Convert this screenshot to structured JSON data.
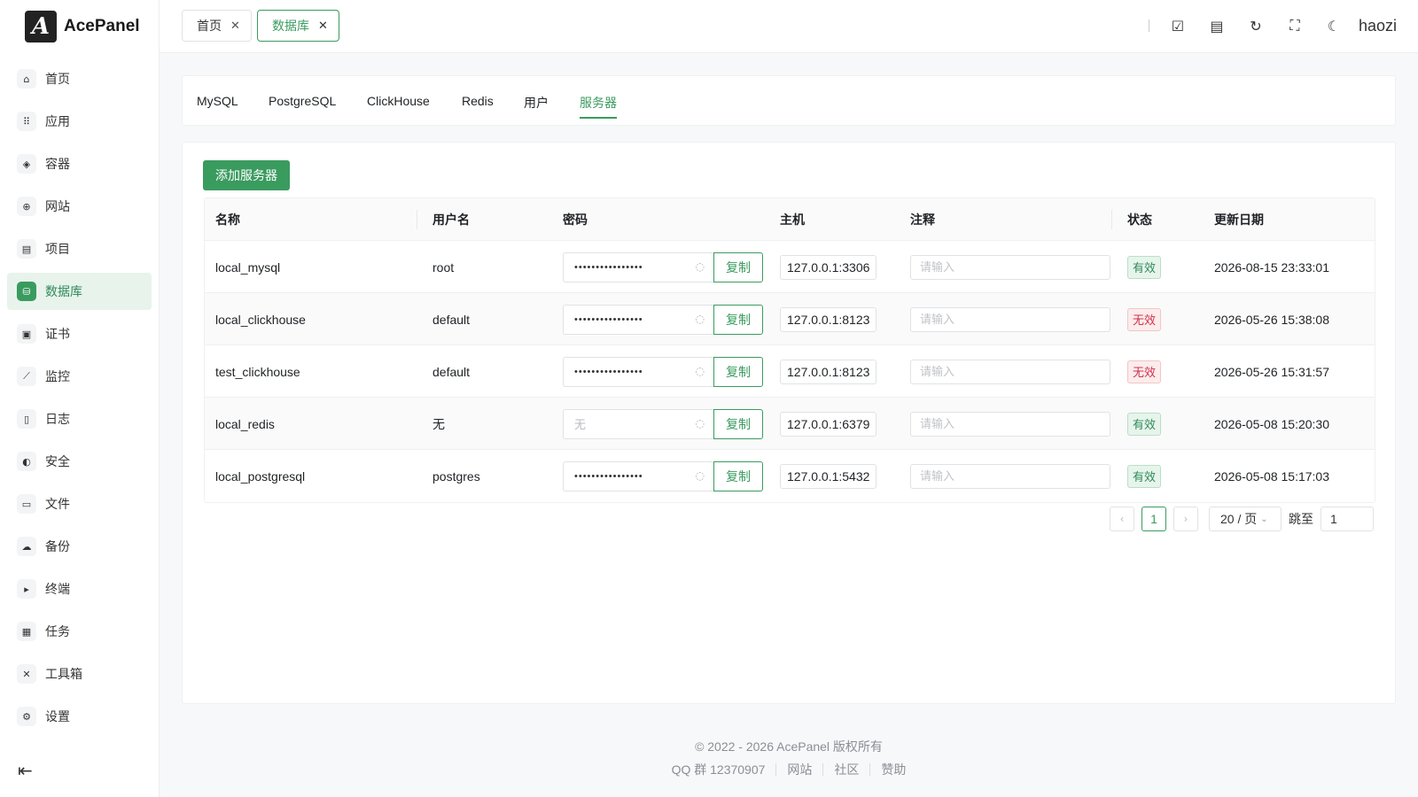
{
  "app": {
    "logo_letter": "A",
    "name": "AcePanel"
  },
  "sidebar": {
    "items": [
      {
        "label": "首页",
        "icon": "home-icon",
        "glyph": "⌂",
        "active": false
      },
      {
        "label": "应用",
        "icon": "apps-grid-icon",
        "glyph": "⠿",
        "active": false
      },
      {
        "label": "容器",
        "icon": "layers-icon",
        "glyph": "◈",
        "active": false
      },
      {
        "label": "网站",
        "icon": "globe-icon",
        "glyph": "⊕",
        "active": false
      },
      {
        "label": "项目",
        "icon": "folders-icon",
        "glyph": "▤",
        "active": false
      },
      {
        "label": "数据库",
        "icon": "database-icon",
        "glyph": "⛁",
        "active": true
      },
      {
        "label": "证书",
        "icon": "certificate-icon",
        "glyph": "▣",
        "active": false
      },
      {
        "label": "监控",
        "icon": "chart-line-icon",
        "glyph": "⟋",
        "active": false
      },
      {
        "label": "日志",
        "icon": "document-icon",
        "glyph": "▯",
        "active": false
      },
      {
        "label": "安全",
        "icon": "shield-icon",
        "glyph": "◐",
        "active": false
      },
      {
        "label": "文件",
        "icon": "folder-open-icon",
        "glyph": "▭",
        "active": false
      },
      {
        "label": "备份",
        "icon": "cloud-upload-icon",
        "glyph": "☁",
        "active": false
      },
      {
        "label": "终端",
        "icon": "terminal-icon",
        "glyph": "▸",
        "active": false
      },
      {
        "label": "任务",
        "icon": "calendar-task-icon",
        "glyph": "▦",
        "active": false
      },
      {
        "label": "工具箱",
        "icon": "tools-icon",
        "glyph": "✕",
        "active": false
      },
      {
        "label": "设置",
        "icon": "gear-icon",
        "glyph": "⚙",
        "active": false
      }
    ],
    "collapse_glyph": "⇤"
  },
  "topbar": {
    "tabs": [
      {
        "label": "首页",
        "active": false
      },
      {
        "label": "数据库",
        "active": true
      }
    ],
    "close_glyph": "✕",
    "icons": [
      {
        "name": "checklist-icon",
        "glyph": "☑"
      },
      {
        "name": "file-text-icon",
        "glyph": "▤"
      },
      {
        "name": "refresh-icon",
        "glyph": "↻"
      },
      {
        "name": "fullscreen-icon",
        "glyph": "⛶"
      },
      {
        "name": "theme-moon-icon",
        "glyph": "☾"
      }
    ],
    "username": "haozi"
  },
  "db_tabs": [
    "MySQL",
    "PostgreSQL",
    "ClickHouse",
    "Redis",
    "用户",
    "服务器"
  ],
  "db_tabs_active": "服务器",
  "main": {
    "add_button": "添加服务器",
    "columns": [
      "名称",
      "用户名",
      "密码",
      "主机",
      "注释",
      "状态",
      "更新日期"
    ],
    "copy_label": "复制",
    "note_placeholder": "请输入",
    "rows": [
      {
        "name": "local_mysql",
        "username": "root",
        "password_display": "••••••••••••••••",
        "password_empty": false,
        "host": "127.0.0.1:3306",
        "status": "有效",
        "status_ok": true,
        "updated": "2026-08-15 23:33:01"
      },
      {
        "name": "local_clickhouse",
        "username": "default",
        "password_display": "••••••••••••••••",
        "password_empty": false,
        "host": "127.0.0.1:8123",
        "status": "无效",
        "status_ok": false,
        "updated": "2026-05-26 15:38:08"
      },
      {
        "name": "test_clickhouse",
        "username": "default",
        "password_display": "••••••••••••••••",
        "password_empty": false,
        "host": "127.0.0.1:8123",
        "status": "无效",
        "status_ok": false,
        "updated": "2026-05-26 15:31:57"
      },
      {
        "name": "local_redis",
        "username": "无",
        "password_display": "无",
        "password_empty": true,
        "host": "127.0.0.1:6379",
        "status": "有效",
        "status_ok": true,
        "updated": "2026-05-08 15:20:30"
      },
      {
        "name": "local_postgresql",
        "username": "postgres",
        "password_display": "••••••••••••••••",
        "password_empty": false,
        "host": "127.0.0.1:5432",
        "status": "有效",
        "status_ok": true,
        "updated": "2026-05-08 15:17:03"
      }
    ]
  },
  "pagination": {
    "prev": "‹",
    "next": "›",
    "current_page": "1",
    "page_size": "20 / 页",
    "jump_label": "跳至",
    "jump_value": "1"
  },
  "footer": {
    "copyright": "© 2022 - 2026 AcePanel 版权所有",
    "qq": "QQ 群 12370907",
    "links": [
      "网站",
      "社区",
      "赞助"
    ]
  },
  "colors": {
    "accent": "#3a9b5f",
    "danger": "#d03050"
  }
}
